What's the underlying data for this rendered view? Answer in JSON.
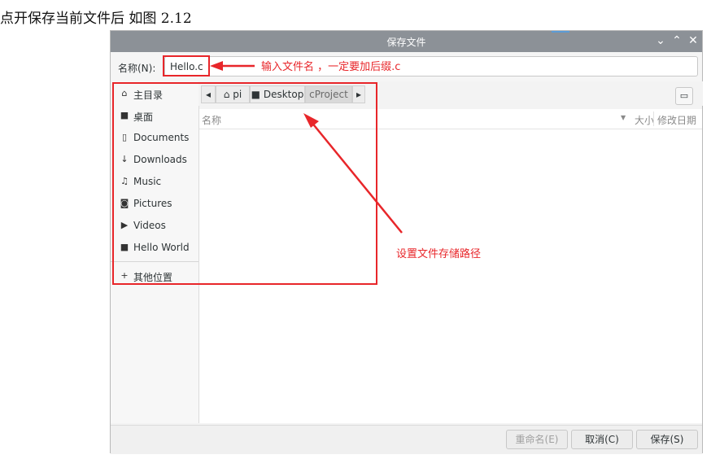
{
  "document": {
    "heading": "点开保存当前文件后 如图 2.12"
  },
  "dialog": {
    "title": "保存文件",
    "controls": {
      "minimize": "⌄",
      "maximize": "⌃",
      "close": "✕"
    },
    "name_label": "名称(N):",
    "file_name": "Hello.c"
  },
  "sidebar": {
    "items": [
      {
        "label": "主目录",
        "icon": "home-icon"
      },
      {
        "label": "桌面",
        "icon": "folder-icon"
      },
      {
        "label": "Documents",
        "icon": "document-icon"
      },
      {
        "label": "Downloads",
        "icon": "download-icon"
      },
      {
        "label": "Music",
        "icon": "music-icon"
      },
      {
        "label": "Pictures",
        "icon": "camera-icon"
      },
      {
        "label": "Videos",
        "icon": "video-icon"
      },
      {
        "label": "Hello World",
        "icon": "folder-icon"
      }
    ],
    "other_locations": "其他位置"
  },
  "pathbar": {
    "segments": [
      "pi",
      "Desktop",
      "cProject"
    ],
    "current": "cProject"
  },
  "columns": {
    "name": "名称",
    "size": "大小",
    "modified": "修改日期"
  },
  "buttons": {
    "rename": "重命名(E)",
    "cancel": "取消(C)",
    "save": "保存(S)"
  },
  "annotations": {
    "filename_hint": "输入文件名 ，一定要加后缀.c",
    "path_hint": "设置文件存储路径",
    "color": "#e8262a"
  }
}
